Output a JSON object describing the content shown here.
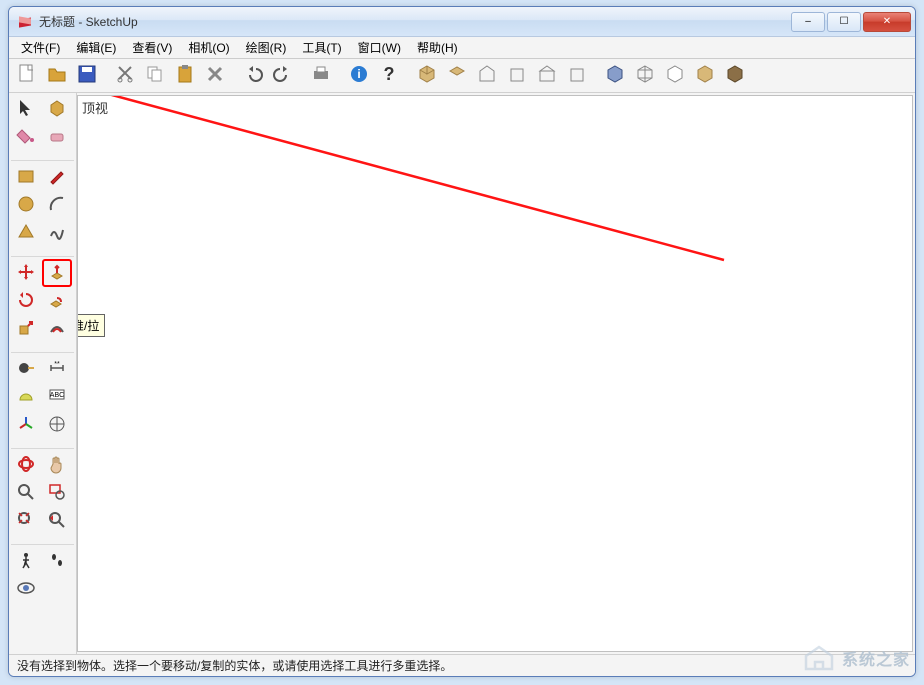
{
  "window": {
    "title": "无标题 - SketchUp"
  },
  "menu": {
    "file": "文件(F)",
    "edit": "编辑(E)",
    "view": "查看(V)",
    "camera": "相机(O)",
    "draw": "绘图(R)",
    "tools": "工具(T)",
    "window_m": "窗口(W)",
    "help": "帮助(H)"
  },
  "canvas": {
    "view_label": "顶视"
  },
  "tooltip": {
    "push_pull": "推/拉"
  },
  "status": {
    "message": "没有选择到物体。选择一个要移动/复制的实体，或请使用选择工具进行多重选择。"
  },
  "watermark": {
    "text": "系统之家"
  },
  "icons": {
    "app": "sketchup-icon",
    "min": "–",
    "max": "☐",
    "close": "✕"
  }
}
